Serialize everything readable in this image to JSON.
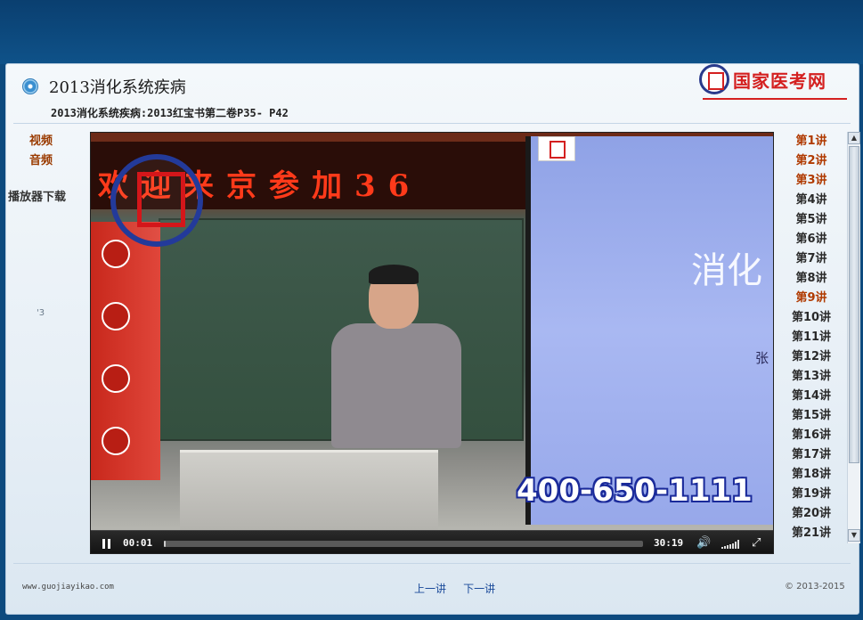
{
  "header": {
    "title": "2013消化系统疾病",
    "subtitle": "2013消化系统疾病:2013红宝书第二卷P35- P42",
    "logo_text": "国家医考网"
  },
  "left_nav": {
    "video_label": "视频",
    "audio_label": "音频",
    "download_label": "播放器下载",
    "small_mark": "'3"
  },
  "video": {
    "led_text": "欢迎来京参加36",
    "screen_text": "消化",
    "screen_text_small": "张",
    "phone_number": "400-650-1111",
    "controls": {
      "current_time": "00:01",
      "total_time": "30:19",
      "progress_fraction": 0.002
    }
  },
  "lectures": [
    {
      "label": "第1讲",
      "active": true
    },
    {
      "label": "第2讲",
      "active": true
    },
    {
      "label": "第3讲",
      "active": true
    },
    {
      "label": "第4讲",
      "active": false
    },
    {
      "label": "第5讲",
      "active": false
    },
    {
      "label": "第6讲",
      "active": false
    },
    {
      "label": "第7讲",
      "active": false
    },
    {
      "label": "第8讲",
      "active": false
    },
    {
      "label": "第9讲",
      "active": true
    },
    {
      "label": "第10讲",
      "active": false
    },
    {
      "label": "第11讲",
      "active": false
    },
    {
      "label": "第12讲",
      "active": false
    },
    {
      "label": "第13讲",
      "active": false
    },
    {
      "label": "第14讲",
      "active": false
    },
    {
      "label": "第15讲",
      "active": false
    },
    {
      "label": "第16讲",
      "active": false
    },
    {
      "label": "第17讲",
      "active": false
    },
    {
      "label": "第18讲",
      "active": false
    },
    {
      "label": "第19讲",
      "active": false
    },
    {
      "label": "第20讲",
      "active": false
    },
    {
      "label": "第21讲",
      "active": false
    }
  ],
  "footer": {
    "site": "www.guojiayikao.com",
    "prev_label": "上一讲",
    "next_label": "下一讲",
    "copyright": "© 2013-2015"
  },
  "colors": {
    "background": "#0d4a7e",
    "accent_red": "#d42020",
    "link_active": "#b03a00",
    "link_blue": "#1a4a9a"
  }
}
